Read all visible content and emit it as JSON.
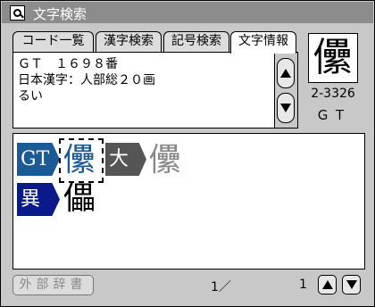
{
  "window": {
    "title": "文字検索",
    "title_icon": "magnifier-icon"
  },
  "tabs": [
    {
      "label": "コード一覧",
      "active": false
    },
    {
      "label": "漢字検索",
      "active": false
    },
    {
      "label": "記号検索",
      "active": false
    },
    {
      "label": "文字情報",
      "active": true
    }
  ],
  "info": {
    "lines": [
      "ＧＴ　１６９８番",
      "日本漢字：人部総２０画",
      "るい"
    ]
  },
  "preview": {
    "kanji": "儽",
    "code": "2-3326",
    "font": "ＧＴ"
  },
  "results": {
    "rows": [
      {
        "badge": "GT",
        "badge_color": "#1a5a96",
        "items": [
          "儽"
        ],
        "selected_index": 0,
        "badge2": "大",
        "badge2_color": "#555555",
        "items2": [
          "儽"
        ]
      },
      {
        "badge": "異",
        "badge_color": "#0a1a8c",
        "items": [
          "儡"
        ]
      }
    ]
  },
  "bottom": {
    "external_dict_label": "外部辞書",
    "page_current": "1／",
    "page_total": "1"
  },
  "colors": {
    "titlebar": "#8c8c8c",
    "background": "#c8c8c8",
    "selected_kanji": "#1a5a96",
    "gray_kanji": "#888888"
  }
}
